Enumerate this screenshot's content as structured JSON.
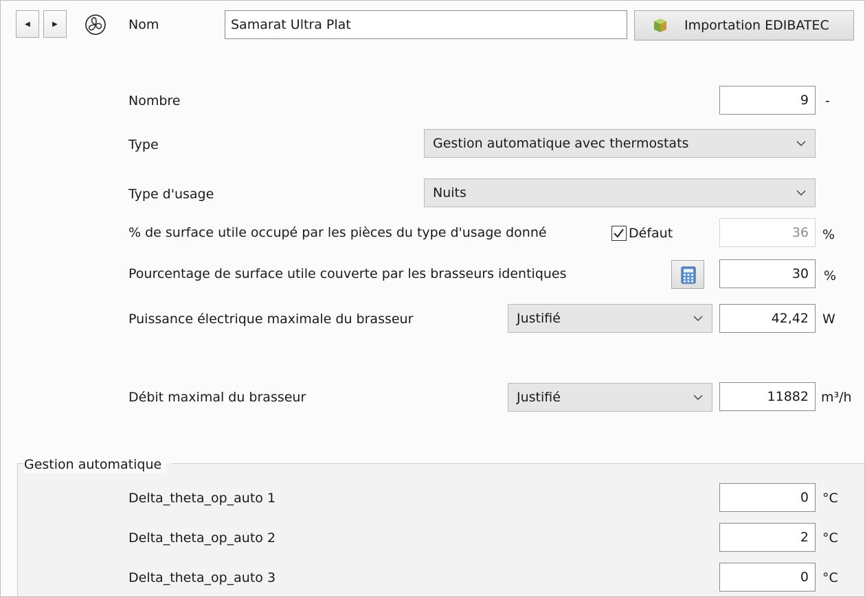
{
  "header": {
    "name_label": "Nom",
    "name_value": "Samarat Ultra Plat",
    "import_button_label": "Importation EDIBATEC"
  },
  "fields": {
    "nombre": {
      "label": "Nombre",
      "value": "9",
      "unit": "-"
    },
    "type": {
      "label": "Type",
      "selected": "Gestion automatique avec thermostats"
    },
    "type_usage": {
      "label": "Type d'usage",
      "selected": "Nuits"
    },
    "pct_surface_occupee": {
      "label": "% de surface utile occupé par les pièces du type d'usage donné",
      "checkbox_label": "Défaut",
      "checked": true,
      "value": "36",
      "unit": "%"
    },
    "pct_surface_couverte": {
      "label": "Pourcentage de surface utile couverte par les brasseurs identiques",
      "value": "30",
      "unit": "%"
    },
    "puissance": {
      "label": "Puissance électrique maximale du brasseur",
      "selected": "Justifié",
      "value": "42,42",
      "unit": "W"
    },
    "debit": {
      "label": "Débit maximal du brasseur",
      "selected": "Justifié",
      "value": "11882",
      "unit": "m³/h"
    }
  },
  "gestion_automatique": {
    "title": "Gestion automatique",
    "rows": [
      {
        "label": "Delta_theta_op_auto 1",
        "value": "0",
        "unit": "°C"
      },
      {
        "label": "Delta_theta_op_auto 2",
        "value": "2",
        "unit": "°C"
      },
      {
        "label": "Delta_theta_op_auto 3",
        "value": "0",
        "unit": "°C"
      }
    ]
  },
  "icons": {
    "prev": "triangle-left-icon",
    "next": "triangle-right-icon",
    "fan": "fan-icon",
    "import": "cube-icon",
    "calculator": "calculator-icon",
    "dropdown": "chevron-down-icon"
  }
}
